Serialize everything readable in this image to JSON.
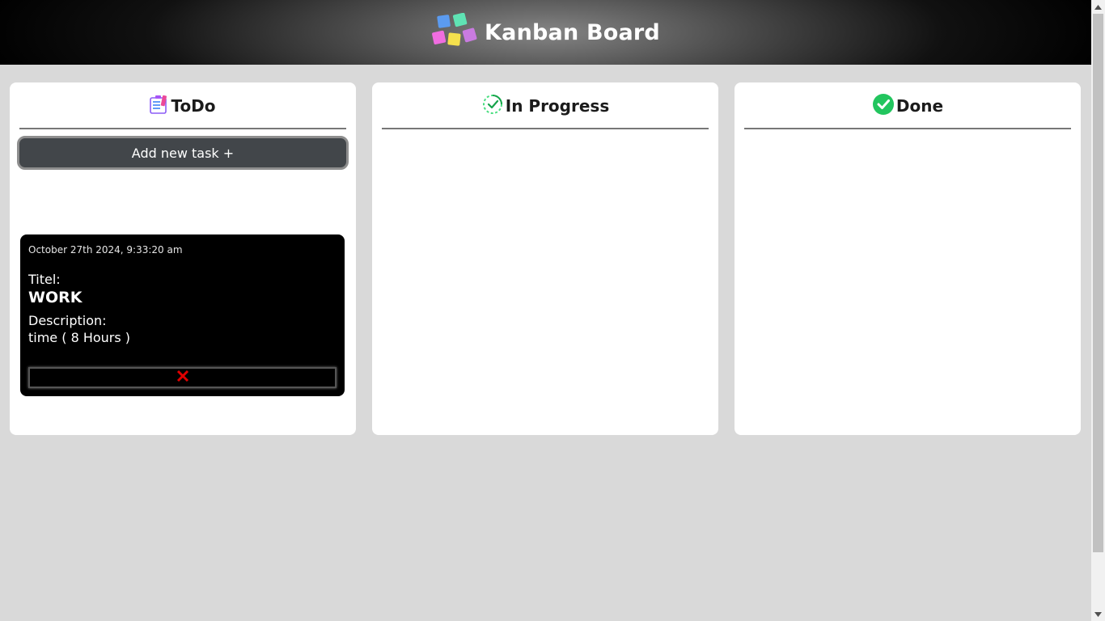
{
  "header": {
    "title": "Kanban Board",
    "logo_icon": "sticky-notes-icon"
  },
  "columns": [
    {
      "title": "ToDo",
      "icon": "todo-list-icon",
      "add_button_label": "Add new task +",
      "tasks": [
        {
          "date": "October 27th 2024, 9:33:20 am",
          "title_label": "Titel:",
          "title": "WORK",
          "description_label": "Description:",
          "description": "time ( 8 Hours )",
          "delete_icon": "close-icon"
        }
      ]
    },
    {
      "title": "In Progress",
      "icon": "in-progress-check-icon",
      "tasks": []
    },
    {
      "title": "Done",
      "icon": "done-check-icon",
      "tasks": []
    }
  ],
  "colors": {
    "background": "#d9d9d9",
    "card": "#000000",
    "button": "#42464a",
    "delete": "#e00000",
    "done_green": "#22c55e"
  }
}
